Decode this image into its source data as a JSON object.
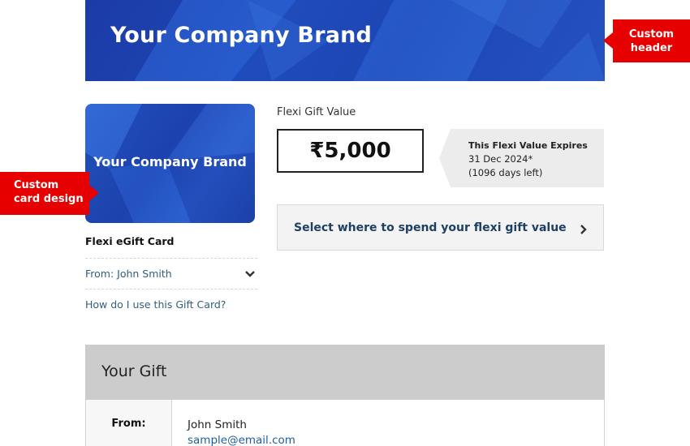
{
  "header": {
    "brand_title": "Your Company Brand",
    "background_color": "#1f49b8"
  },
  "callouts": {
    "header_line1": "Custom",
    "header_line2": "header",
    "card_line1": "Custom",
    "card_line2": "card design",
    "color": "#e60000"
  },
  "card": {
    "brand_title": "Your Company Brand",
    "type_label": "Flexi eGift Card",
    "from_label": "From: John Smith",
    "help_link": "How do I use this Gift Card?"
  },
  "value": {
    "label": "Flexi Gift Value",
    "amount": "₹5,000",
    "expiry_title": "This Flexi Value Expires",
    "expiry_date": "31 Dec 2024*",
    "expiry_days_left": "(1096 days left)"
  },
  "select": {
    "label": "Select where to spend your flexi gift value"
  },
  "gift": {
    "section_title": "Your Gift",
    "from_label": "From:",
    "from_name": "John Smith",
    "from_email": "sample@email.com"
  }
}
